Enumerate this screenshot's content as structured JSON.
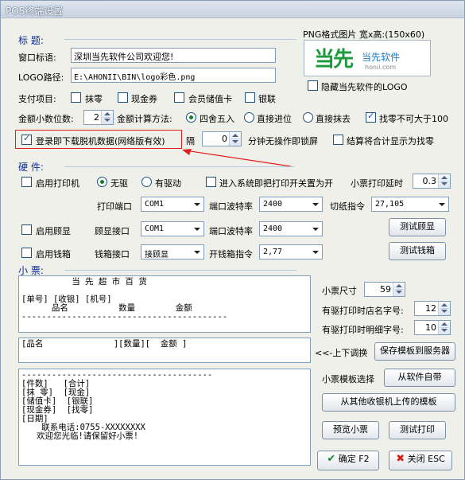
{
  "window": {
    "title": "POS终端设置"
  },
  "header": {
    "section_label": "标    题:",
    "logo_hint": "PNG格式图片 宽x高:(150x60)"
  },
  "title_fields": {
    "window_title_label": "窗口标语:",
    "window_title_value": "深圳当先软件公司欢迎您!",
    "logo_path_label": "LOGO路径:",
    "logo_path_value": "E:\\AHONII\\BIN\\logo彩色.png"
  },
  "logo_image": {
    "main_text": "当先",
    "sub_text": "当先软件",
    "site": "honii.com"
  },
  "hide_logo": {
    "label": "隐藏当先软件的LOGO",
    "checked": false
  },
  "payment": {
    "label": "支付项目:",
    "options": [
      {
        "label": "抹零",
        "checked": false
      },
      {
        "label": "现金券",
        "checked": false
      },
      {
        "label": "会员储值卡",
        "checked": false
      },
      {
        "label": "银联",
        "checked": false
      }
    ]
  },
  "amounts": {
    "decimal_label": "金额小数位数:",
    "decimal_value": "2",
    "calc_label": "金额计算方法:",
    "methods": [
      "四舍五入",
      "直接进位",
      "直接抹去"
    ],
    "method_selected": "四舍五入",
    "change_limit_label": "找零不可大于100",
    "change_limit_checked": true
  },
  "login_download": {
    "label": "登录即下载脱机数据(网络版有效)",
    "checked": true,
    "interval_label": "隔",
    "interval_value": "0",
    "interval_suffix": "分钟无操作即锁屏"
  },
  "settle_checkout": {
    "label": "结算将合计显示为找零",
    "checked": false
  },
  "hardware": {
    "section_label": "硬    件:",
    "enable_printer": "启用打印机",
    "driver_options": [
      "无驱",
      "有驱动"
    ],
    "driver_selected": "无驱",
    "lock_printer_label": "进入系统即把打印开关置为开",
    "lock_printer_checked": false,
    "print_delay_label": "小票打印延时",
    "print_delay_value": "0.3",
    "print_port_label": "打印端口",
    "print_port_value": "COM1",
    "baud_label": "端口波特率",
    "baud_value": "2400",
    "cut_label": "切纸指令",
    "cut_value": "27,105",
    "enable_display": "启用顾显",
    "display_port_label": "顾显接口",
    "display_port_value": "COM1",
    "display_baud_value": "2400",
    "test_display": "测试顾显",
    "enable_drawer": "启用钱箱",
    "drawer_port_label": "钱箱接口",
    "drawer_port_value": "接顾显",
    "drawer_cmd_label": "开钱箱指令",
    "drawer_cmd_value": "2,77",
    "test_drawer": "测试钱箱"
  },
  "receipt": {
    "section_label": "小    票:",
    "header_text": "          当 先 超 市 百 货\n\n[单号] [收银] [机号]\n      品名          数量        金额\n-----------------------------------------",
    "detail_text": "[品名              ][数量][  金额 ]",
    "footer_text": "--------------------------------------\n[件数]   [合计]\n[抹 零]  [现金]\n[储值卡]  [银联]\n[现金券]  [找零]\n[日期]\n    联系电话:0755-XXXXXXXX\n   欢迎您光临!请保留好小票!",
    "size_label": "小票尺寸",
    "size_value": "59",
    "shop_font_label": "有驱打印时店名字号:",
    "shop_font_value": "12",
    "detail_font_label": "有驱打印时明细字号:",
    "detail_font_value": "10",
    "swap_label": "<<-上下调换",
    "save_template": "保存模板到服务器",
    "template_choose_label": "小票模板选择",
    "from_software": "从软件自带",
    "from_other": "从其他收银机上传的模板",
    "preview": "预览小票",
    "test_print": "测试打印"
  },
  "footer": {
    "ok": "确定 F2",
    "close": "关闭 ESC"
  },
  "colors": {
    "section": "#0b2d9c",
    "annotation": "#e0201e",
    "check": "#1b4fa0",
    "radio": "#1c7a26"
  }
}
